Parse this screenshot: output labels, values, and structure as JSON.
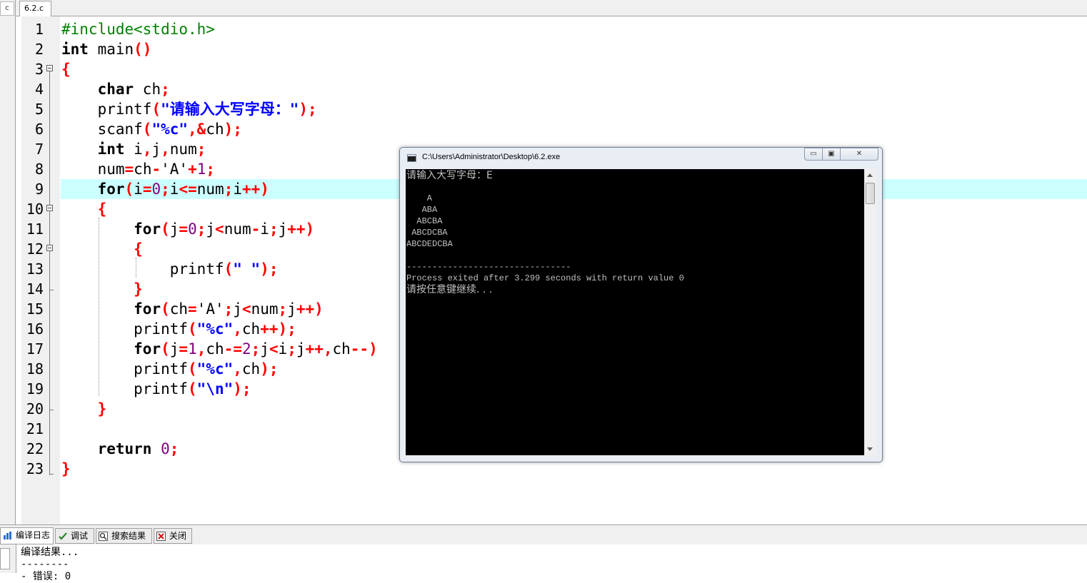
{
  "left_panel": {
    "stub_glyph": "c"
  },
  "tabbar": {
    "file_tab": "6.2.c"
  },
  "editor": {
    "current_line": 9,
    "lines": [
      {
        "n": "1",
        "parts": [
          [
            "pp",
            "#include<stdio.h>"
          ]
        ]
      },
      {
        "n": "2",
        "parts": [
          [
            "kw",
            "int"
          ],
          [
            "",
            " main"
          ],
          [
            "sym",
            "()"
          ]
        ]
      },
      {
        "n": "3",
        "parts": [
          [
            "sym",
            "{"
          ]
        ]
      },
      {
        "n": "4",
        "parts": [
          [
            "",
            "    "
          ],
          [
            "kw",
            "char"
          ],
          [
            "",
            " ch"
          ],
          [
            "sym",
            ";"
          ]
        ]
      },
      {
        "n": "5",
        "parts": [
          [
            "",
            "    printf"
          ],
          [
            "sym",
            "("
          ],
          [
            "str",
            "\"请输入大写字母：\""
          ],
          [
            "sym",
            ");"
          ]
        ]
      },
      {
        "n": "6",
        "parts": [
          [
            "",
            "    scanf"
          ],
          [
            "sym",
            "("
          ],
          [
            "str",
            "\"%c\""
          ],
          [
            "sym",
            ",&"
          ],
          [
            "",
            "ch"
          ],
          [
            "sym",
            ");"
          ]
        ]
      },
      {
        "n": "7",
        "parts": [
          [
            "",
            "    "
          ],
          [
            "kw",
            "int"
          ],
          [
            "",
            " i"
          ],
          [
            "sym",
            ","
          ],
          [
            "",
            "j"
          ],
          [
            "sym",
            ","
          ],
          [
            "",
            "num"
          ],
          [
            "sym",
            ";"
          ]
        ]
      },
      {
        "n": "8",
        "parts": [
          [
            "",
            "    num"
          ],
          [
            "sym",
            "="
          ],
          [
            "",
            "ch"
          ],
          [
            "sym",
            "-"
          ],
          [
            "",
            "'A'"
          ],
          [
            "sym",
            "+"
          ],
          [
            "num",
            "1"
          ],
          [
            "sym",
            ";"
          ]
        ]
      },
      {
        "n": "9",
        "parts": [
          [
            "",
            "    "
          ],
          [
            "kw",
            "for"
          ],
          [
            "sym",
            "("
          ],
          [
            "",
            "i"
          ],
          [
            "sym",
            "="
          ],
          [
            "num",
            "0"
          ],
          [
            "sym",
            ";"
          ],
          [
            "",
            "i"
          ],
          [
            "sym",
            "<="
          ],
          [
            "",
            "num"
          ],
          [
            "sym",
            ";"
          ],
          [
            "",
            "i"
          ],
          [
            "sym",
            "++)"
          ]
        ]
      },
      {
        "n": "10",
        "parts": [
          [
            "",
            "    "
          ],
          [
            "sym",
            "{"
          ]
        ]
      },
      {
        "n": "11",
        "parts": [
          [
            "",
            "        "
          ],
          [
            "kw",
            "for"
          ],
          [
            "sym",
            "("
          ],
          [
            "",
            "j"
          ],
          [
            "sym",
            "="
          ],
          [
            "num",
            "0"
          ],
          [
            "sym",
            ";"
          ],
          [
            "",
            "j"
          ],
          [
            "sym",
            "<"
          ],
          [
            "",
            "num"
          ],
          [
            "sym",
            "-"
          ],
          [
            "",
            "i"
          ],
          [
            "sym",
            ";"
          ],
          [
            "",
            "j"
          ],
          [
            "sym",
            "++)"
          ]
        ]
      },
      {
        "n": "12",
        "parts": [
          [
            "",
            "        "
          ],
          [
            "sym",
            "{"
          ]
        ]
      },
      {
        "n": "13",
        "parts": [
          [
            "",
            "            printf"
          ],
          [
            "sym",
            "("
          ],
          [
            "str",
            "\" \""
          ],
          [
            "sym",
            ");"
          ]
        ]
      },
      {
        "n": "14",
        "parts": [
          [
            "",
            "        "
          ],
          [
            "sym",
            "}"
          ]
        ]
      },
      {
        "n": "15",
        "parts": [
          [
            "",
            "        "
          ],
          [
            "kw",
            "for"
          ],
          [
            "sym",
            "("
          ],
          [
            "",
            "ch"
          ],
          [
            "sym",
            "="
          ],
          [
            "",
            "'A'"
          ],
          [
            "sym",
            ";"
          ],
          [
            "",
            "j"
          ],
          [
            "sym",
            "<"
          ],
          [
            "",
            "num"
          ],
          [
            "sym",
            ";"
          ],
          [
            "",
            "j"
          ],
          [
            "sym",
            "++)"
          ]
        ]
      },
      {
        "n": "16",
        "parts": [
          [
            "",
            "        printf"
          ],
          [
            "sym",
            "("
          ],
          [
            "str",
            "\"%c\""
          ],
          [
            "sym",
            ","
          ],
          [
            "",
            "ch"
          ],
          [
            "sym",
            "++);"
          ]
        ]
      },
      {
        "n": "17",
        "parts": [
          [
            "",
            "        "
          ],
          [
            "kw",
            "for"
          ],
          [
            "sym",
            "("
          ],
          [
            "",
            "j"
          ],
          [
            "sym",
            "="
          ],
          [
            "num",
            "1"
          ],
          [
            "sym",
            ","
          ],
          [
            "",
            "ch"
          ],
          [
            "sym",
            "-="
          ],
          [
            "num",
            "2"
          ],
          [
            "sym",
            ";"
          ],
          [
            "",
            "j"
          ],
          [
            "sym",
            "<"
          ],
          [
            "",
            "i"
          ],
          [
            "sym",
            ";"
          ],
          [
            "",
            "j"
          ],
          [
            "sym",
            "++,"
          ],
          [
            "",
            "ch"
          ],
          [
            "sym",
            "--)"
          ]
        ]
      },
      {
        "n": "18",
        "parts": [
          [
            "",
            "        printf"
          ],
          [
            "sym",
            "("
          ],
          [
            "str",
            "\"%c\""
          ],
          [
            "sym",
            ","
          ],
          [
            "",
            "ch"
          ],
          [
            "sym",
            ");"
          ]
        ]
      },
      {
        "n": "19",
        "parts": [
          [
            "",
            "        printf"
          ],
          [
            "sym",
            "("
          ],
          [
            "str",
            "\"\\n\""
          ],
          [
            "sym",
            ");"
          ]
        ]
      },
      {
        "n": "20",
        "parts": [
          [
            "",
            "    "
          ],
          [
            "sym",
            "}"
          ]
        ]
      },
      {
        "n": "21",
        "parts": []
      },
      {
        "n": "22",
        "parts": [
          [
            "",
            "    "
          ],
          [
            "kw",
            "return"
          ],
          [
            "",
            " "
          ],
          [
            "num",
            "0"
          ],
          [
            "sym",
            ";"
          ]
        ]
      },
      {
        "n": "23",
        "parts": [
          [
            "sym",
            "}"
          ]
        ]
      }
    ]
  },
  "console": {
    "title": "C:\\Users\\Administrator\\Desktop\\6.2.exe",
    "buttons": {
      "minimize": "▭",
      "maximize": "▣",
      "close": "✕"
    },
    "output": [
      {
        "text": "请输入大写字母：E",
        "cjk": true
      },
      {
        "text": "",
        "cjk": false
      },
      {
        "text": "    A",
        "cjk": false
      },
      {
        "text": "   ABA",
        "cjk": false
      },
      {
        "text": "  ABCBA",
        "cjk": false
      },
      {
        "text": " ABCDCBA",
        "cjk": false
      },
      {
        "text": "ABCDEDCBA",
        "cjk": false
      },
      {
        "text": "",
        "cjk": false
      },
      {
        "text": "--------------------------------",
        "cjk": false
      },
      {
        "text": "Process exited after 3.299 seconds with return value 0",
        "cjk": false
      },
      {
        "text": "请按任意键继续. . .",
        "cjk": true
      }
    ]
  },
  "bottom_tabs": [
    {
      "label": "编译日志",
      "icon": "chart-icon",
      "active": true
    },
    {
      "label": "调试",
      "icon": "check-icon",
      "active": false
    },
    {
      "label": "搜索结果",
      "icon": "search-icon",
      "active": false
    },
    {
      "label": "关闭",
      "icon": "close-icon",
      "active": false
    }
  ],
  "log": {
    "lines": [
      "编译结果...",
      "--------",
      "- 错误: 0"
    ]
  }
}
